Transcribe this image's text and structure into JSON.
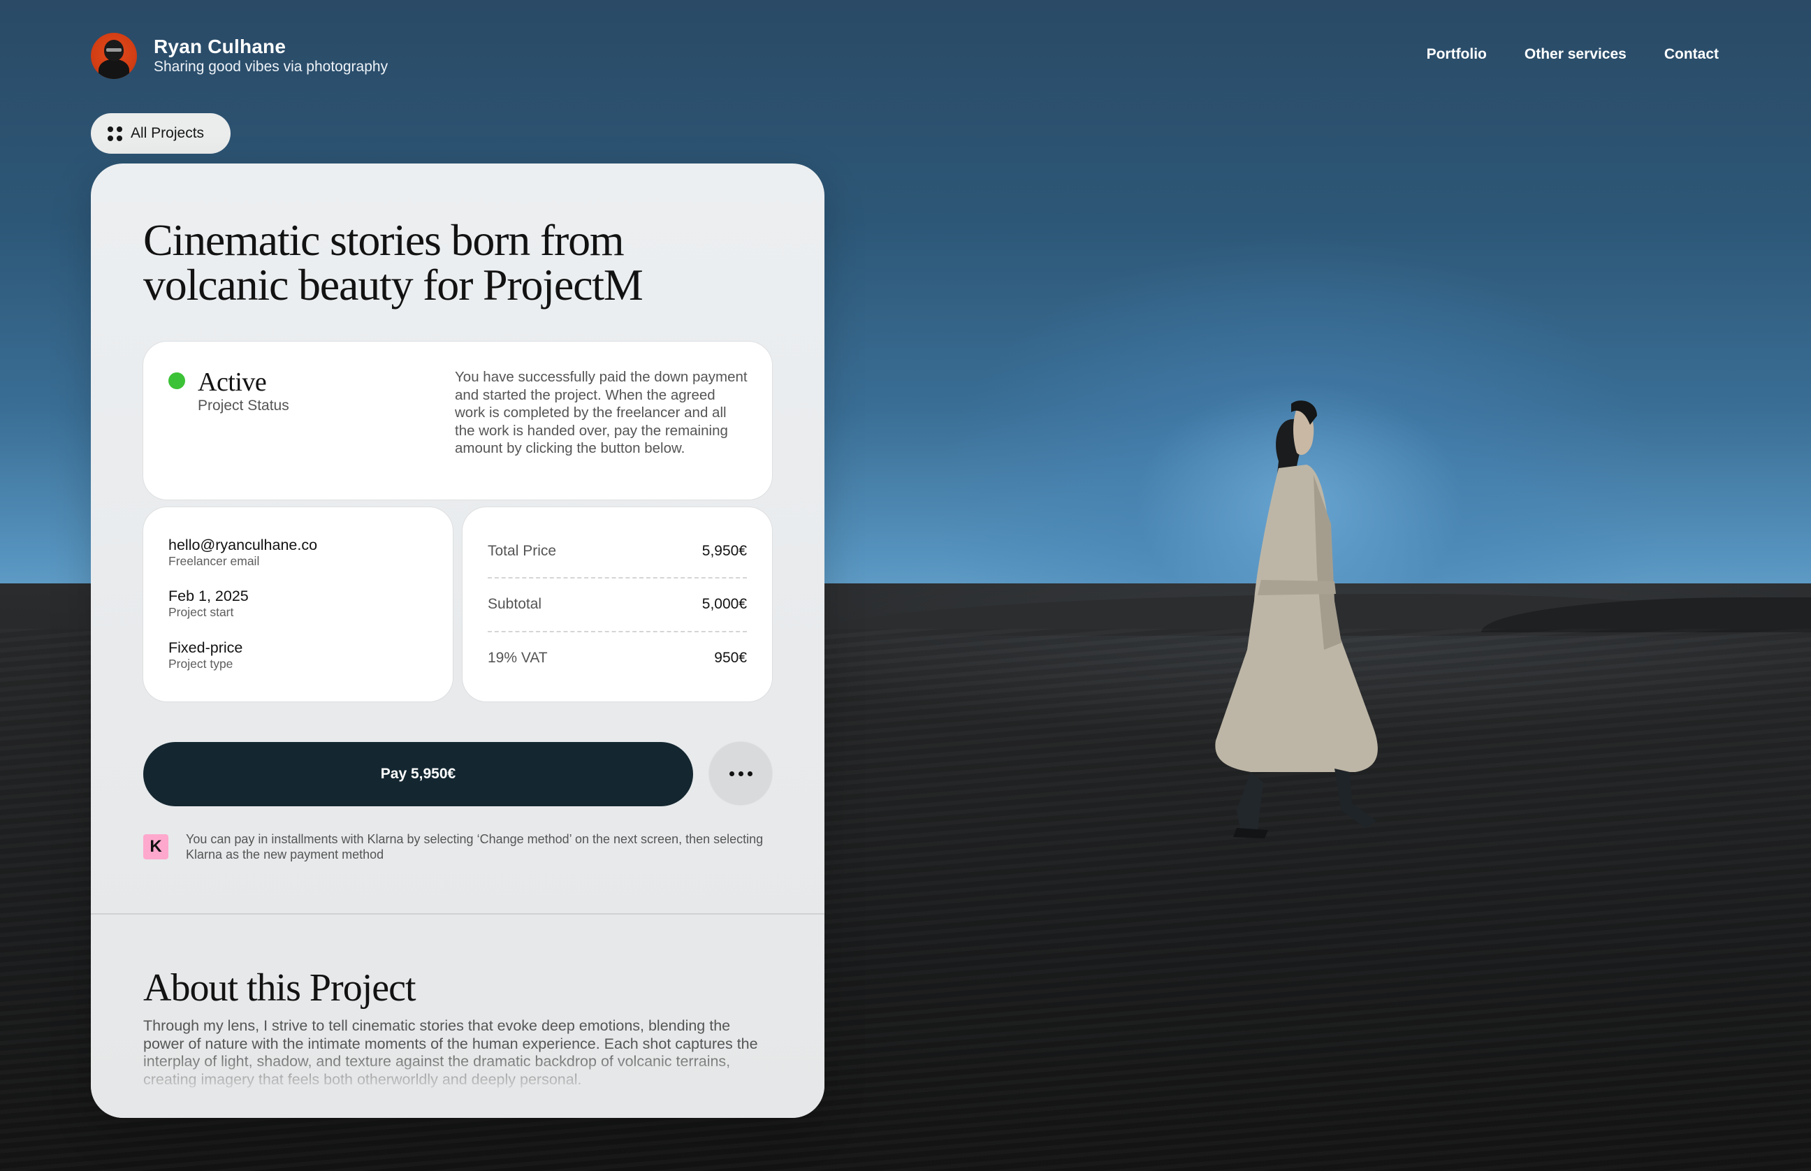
{
  "header": {
    "name": "Ryan Culhane",
    "tagline": "Sharing good vibes via photography",
    "nav": [
      "Portfolio",
      "Other services",
      "Contact"
    ]
  },
  "all_projects_label": "All Projects",
  "project": {
    "title": "Cinematic stories born from volcanic beauty for ProjectM",
    "status": {
      "value": "Active",
      "label": "Project Status",
      "indicator_color": "#3cc236",
      "description": "You have successfully paid the down payment and started the project. When the agreed work is completed by the freelancer and all the work is handed over, pay the remaining amount by clicking the button below."
    },
    "details": [
      {
        "value": "hello@ryanculhane.co",
        "label": "Freelancer email"
      },
      {
        "value": "Feb 1, 2025",
        "label": "Project start"
      },
      {
        "value": "Fixed-price",
        "label": "Project type"
      }
    ],
    "pricing": [
      {
        "label": "Total Price",
        "value": "5,950€"
      },
      {
        "label": "Subtotal",
        "value": "5,000€"
      },
      {
        "label": "19% VAT",
        "value": "950€"
      }
    ],
    "pay_button_label": "Pay 5,950€",
    "klarna_logo_letter": "K",
    "klarna_note": "You can pay in installments with Klarna by selecting  ‘Change method’ on the next screen, then selecting Klarna as the new payment method",
    "about": {
      "title": "About this Project",
      "text": "Through my lens, I strive to tell cinematic stories that evoke deep emotions, blending the power of nature with the intimate moments of the human experience. Each shot captures the interplay of light, shadow, and texture against the dramatic backdrop of volcanic terrains, creating imagery that feels both otherworldly and deeply personal."
    }
  },
  "colors": {
    "pay_button": "#142731",
    "klarna_pink": "#ffa8cd",
    "avatar_orange": "#d33e14"
  }
}
